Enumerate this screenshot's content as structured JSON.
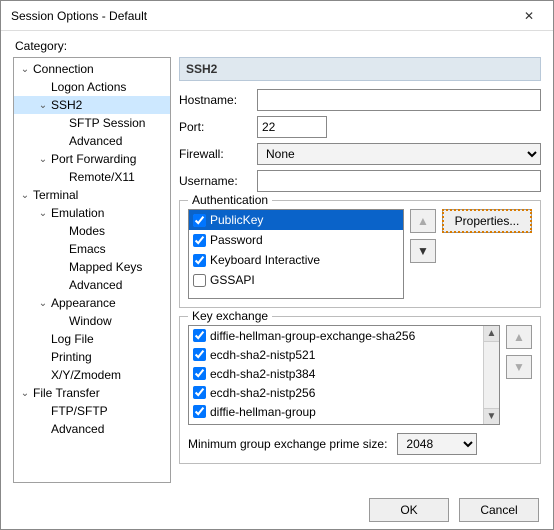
{
  "window": {
    "title": "Session Options - Default"
  },
  "category_label": "Category:",
  "tree": [
    {
      "label": "Connection",
      "indent": 0,
      "exp": true
    },
    {
      "label": "Logon Actions",
      "indent": 1,
      "leaf": true
    },
    {
      "label": "SSH2",
      "indent": 1,
      "exp": true,
      "selected": true
    },
    {
      "label": "SFTP Session",
      "indent": 2,
      "leaf": true
    },
    {
      "label": "Advanced",
      "indent": 2,
      "leaf": true
    },
    {
      "label": "Port Forwarding",
      "indent": 1,
      "exp": true
    },
    {
      "label": "Remote/X11",
      "indent": 2,
      "leaf": true
    },
    {
      "label": "Terminal",
      "indent": 0,
      "exp": true
    },
    {
      "label": "Emulation",
      "indent": 1,
      "exp": true
    },
    {
      "label": "Modes",
      "indent": 2,
      "leaf": true
    },
    {
      "label": "Emacs",
      "indent": 2,
      "leaf": true
    },
    {
      "label": "Mapped Keys",
      "indent": 2,
      "leaf": true
    },
    {
      "label": "Advanced",
      "indent": 2,
      "leaf": true
    },
    {
      "label": "Appearance",
      "indent": 1,
      "exp": true
    },
    {
      "label": "Window",
      "indent": 2,
      "leaf": true
    },
    {
      "label": "Log File",
      "indent": 1,
      "leaf": true
    },
    {
      "label": "Printing",
      "indent": 1,
      "leaf": true
    },
    {
      "label": "X/Y/Zmodem",
      "indent": 1,
      "leaf": true
    },
    {
      "label": "File Transfer",
      "indent": 0,
      "exp": true
    },
    {
      "label": "FTP/SFTP",
      "indent": 1,
      "leaf": true
    },
    {
      "label": "Advanced",
      "indent": 1,
      "leaf": true
    }
  ],
  "header": "SSH2",
  "form": {
    "hostname_label": "Hostname:",
    "hostname_value": "",
    "port_label": "Port:",
    "port_value": "22",
    "firewall_label": "Firewall:",
    "firewall_value": "None",
    "username_label": "Username:",
    "username_value": ""
  },
  "auth": {
    "legend": "Authentication",
    "items": [
      {
        "label": "PublicKey",
        "checked": true,
        "selected": true
      },
      {
        "label": "Password",
        "checked": true
      },
      {
        "label": "Keyboard Interactive",
        "checked": true
      },
      {
        "label": "GSSAPI",
        "checked": false
      }
    ],
    "properties_label": "Properties..."
  },
  "ke": {
    "legend": "Key exchange",
    "items": [
      {
        "label": "diffie-hellman-group-exchange-sha256",
        "checked": true
      },
      {
        "label": "ecdh-sha2-nistp521",
        "checked": true
      },
      {
        "label": "ecdh-sha2-nistp384",
        "checked": true
      },
      {
        "label": "ecdh-sha2-nistp256",
        "checked": true
      },
      {
        "label": "diffie-hellman-group",
        "checked": true
      }
    ],
    "min_label": "Minimum group exchange prime size:",
    "min_value": "2048"
  },
  "buttons": {
    "ok": "OK",
    "cancel": "Cancel"
  }
}
